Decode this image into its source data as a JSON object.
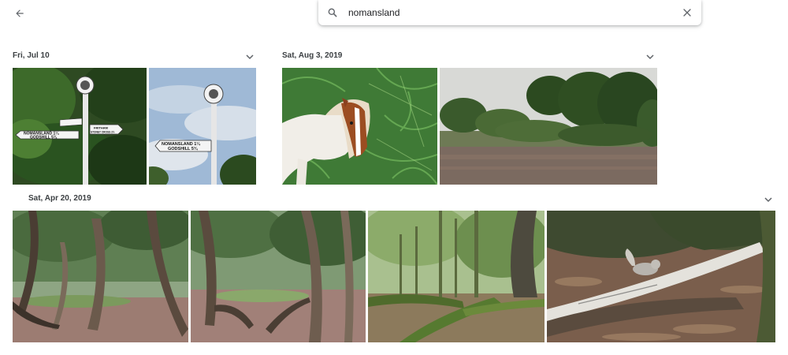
{
  "header": {
    "back_icon": "arrow-back-icon"
  },
  "search": {
    "value": "nomansland",
    "search_icon": "search-icon",
    "clear_icon": "close-icon"
  },
  "groups": [
    {
      "date": "Fri, Jul 10",
      "chevron_icon": "chevron-down-icon"
    },
    {
      "date": "Sat, Aug 3, 2019",
      "chevron_icon": "chevron-down-icon"
    },
    {
      "date": "Sat, Apr 20, 2019",
      "chevron_icon": "chevron-down-icon"
    }
  ],
  "photos": {
    "signpost": {
      "sign_left": "NOMANSLAND 1¼",
      "sign_left_2": "GODSHILL 5¾",
      "sign_right": "FRITHAM",
      "sign_right_2": "STONEY CROSS 2½"
    },
    "signpost_sky": {
      "sign": "NOMANSLAND 1¼",
      "sign_2": "GODSHILL 5¾"
    }
  },
  "colors": {
    "accent": "#5f6368",
    "text": "#3c4043"
  }
}
